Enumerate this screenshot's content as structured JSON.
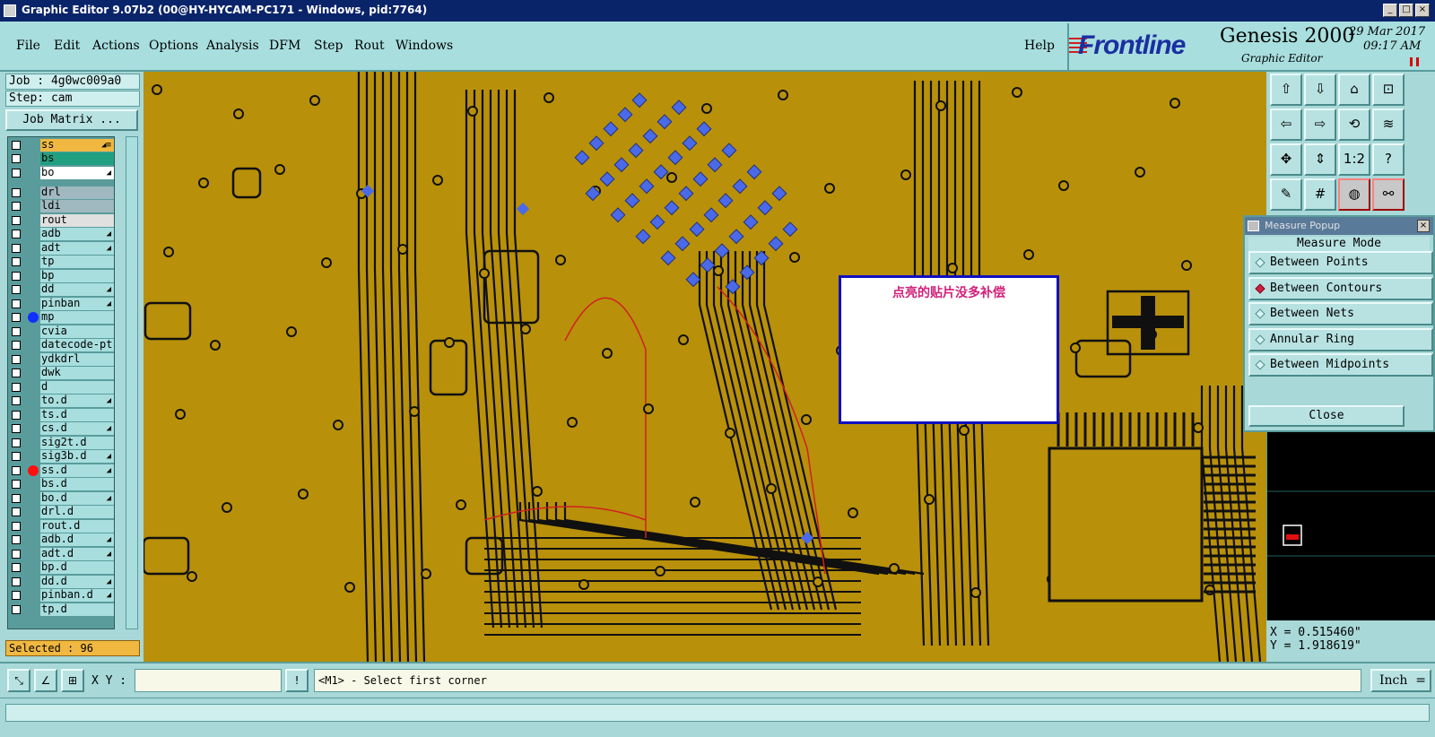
{
  "window": {
    "title": "Graphic Editor 9.07b2 (00@HY-HYCAM-PC171 - Windows, pid:7764)",
    "minimize": "_",
    "maximize": "□",
    "close": "×"
  },
  "menu": [
    "File",
    "Edit",
    "Actions",
    "Options",
    "Analysis",
    "DFM",
    "Step",
    "Rout",
    "Windows"
  ],
  "help": "Help",
  "brand": {
    "logo": "Frontline",
    "product": "Genesis 2000",
    "subtitle": "Graphic Editor",
    "date": "29 Mar 2017",
    "time": "09:17 AM"
  },
  "job": {
    "job_label": "Job : 4g0wc009a0",
    "step_label": "Step: cam",
    "matrix_button": "Job Matrix ..."
  },
  "layers": [
    {
      "name": "ss",
      "flag": "◢≡",
      "color": "#f0b840"
    },
    {
      "name": "bs",
      "flag": "",
      "color": "#20a080"
    },
    {
      "name": "bo",
      "flag": "◢",
      "color": "#ffffff"
    },
    {
      "name": "drl",
      "flag": "",
      "color": "#a0b8c0"
    },
    {
      "name": "ldi",
      "flag": "",
      "color": "#a0b8c0"
    },
    {
      "name": "rout",
      "flag": "",
      "color": "#e0e0e0"
    },
    {
      "name": "adb",
      "flag": "◢",
      "color": "#a8dede"
    },
    {
      "name": "adt",
      "flag": "◢",
      "color": "#a8dede"
    },
    {
      "name": "tp",
      "flag": "",
      "color": "#a8dede"
    },
    {
      "name": "bp",
      "flag": "",
      "color": "#a8dede"
    },
    {
      "name": "dd",
      "flag": "◢",
      "color": "#a8dede"
    },
    {
      "name": "pinban",
      "flag": "◢",
      "color": "#a8dede"
    },
    {
      "name": "mp",
      "flag": "",
      "color": "#a8dede",
      "dot": "#1030ff"
    },
    {
      "name": "cvia",
      "flag": "",
      "color": "#a8dede"
    },
    {
      "name": "datecode-pt",
      "flag": "",
      "color": "#a8dede"
    },
    {
      "name": "ydkdrl",
      "flag": "",
      "color": "#a8dede"
    },
    {
      "name": "dwk",
      "flag": "",
      "color": "#a8dede"
    },
    {
      "name": "d",
      "flag": "",
      "color": "#a8dede"
    },
    {
      "name": "to.d",
      "flag": "◢",
      "color": "#a8dede"
    },
    {
      "name": "ts.d",
      "flag": "",
      "color": "#a8dede"
    },
    {
      "name": "cs.d",
      "flag": "◢",
      "color": "#a8dede"
    },
    {
      "name": "sig2t.d",
      "flag": "",
      "color": "#a8dede"
    },
    {
      "name": "sig3b.d",
      "flag": "◢",
      "color": "#a8dede"
    },
    {
      "name": "ss.d",
      "flag": "◢",
      "color": "#a8dede",
      "dot": "#ff1010"
    },
    {
      "name": "bs.d",
      "flag": "",
      "color": "#a8dede"
    },
    {
      "name": "bo.d",
      "flag": "◢",
      "color": "#a8dede"
    },
    {
      "name": "drl.d",
      "flag": "",
      "color": "#a8dede"
    },
    {
      "name": "rout.d",
      "flag": "",
      "color": "#a8dede"
    },
    {
      "name": "adb.d",
      "flag": "◢",
      "color": "#a8dede"
    },
    {
      "name": "adt.d",
      "flag": "◢",
      "color": "#a8dede"
    },
    {
      "name": "bp.d",
      "flag": "",
      "color": "#a8dede"
    },
    {
      "name": "dd.d",
      "flag": "◢",
      "color": "#a8dede"
    },
    {
      "name": "pinban.d",
      "flag": "◢",
      "color": "#a8dede"
    },
    {
      "name": "tp.d",
      "flag": "",
      "color": "#a8dede"
    }
  ],
  "selected": "Selected : 96",
  "note": "点亮的贴片没多补偿",
  "tools": [
    {
      "icon": "pan-up-icon",
      "glyph": "⇧"
    },
    {
      "icon": "pan-down-icon",
      "glyph": "⇩"
    },
    {
      "icon": "home-icon",
      "glyph": "⌂"
    },
    {
      "icon": "zoom-window-icon",
      "glyph": "⊡"
    },
    {
      "icon": "pan-left-icon",
      "glyph": "⇦"
    },
    {
      "icon": "pan-right-icon",
      "glyph": "⇨"
    },
    {
      "icon": "redraw-icon",
      "glyph": "⟲"
    },
    {
      "icon": "snap-icon",
      "glyph": "≋"
    },
    {
      "icon": "zoom-in-icon",
      "glyph": "✥"
    },
    {
      "icon": "zoom-out-icon",
      "glyph": "⇕"
    },
    {
      "icon": "scale-one-icon",
      "glyph": "1:2"
    },
    {
      "icon": "query-icon",
      "glyph": "?"
    },
    {
      "icon": "palette-icon",
      "glyph": "✎"
    },
    {
      "icon": "grid-icon",
      "glyph": "#"
    },
    {
      "icon": "layers-icon",
      "glyph": "◍"
    },
    {
      "icon": "nets-icon",
      "glyph": "⚯"
    }
  ],
  "measure": {
    "title": "Measure Popup",
    "mode_label": "Measure Mode",
    "options": [
      {
        "label": "Between Points",
        "selected": false
      },
      {
        "label": "Between Contours",
        "selected": true
      },
      {
        "label": "Between Nets",
        "selected": false
      },
      {
        "label": "Annular Ring",
        "selected": false
      },
      {
        "label": "Between Midpoints",
        "selected": false
      }
    ],
    "close_label": "Close"
  },
  "coords": {
    "x": "X = 0.515460\"",
    "y": "Y = 1.918619\""
  },
  "status": {
    "xy_label": "X Y :",
    "xy_value": "",
    "warn_glyph": "!",
    "prompt": "<M1> - Select first corner",
    "units": "Inch"
  }
}
